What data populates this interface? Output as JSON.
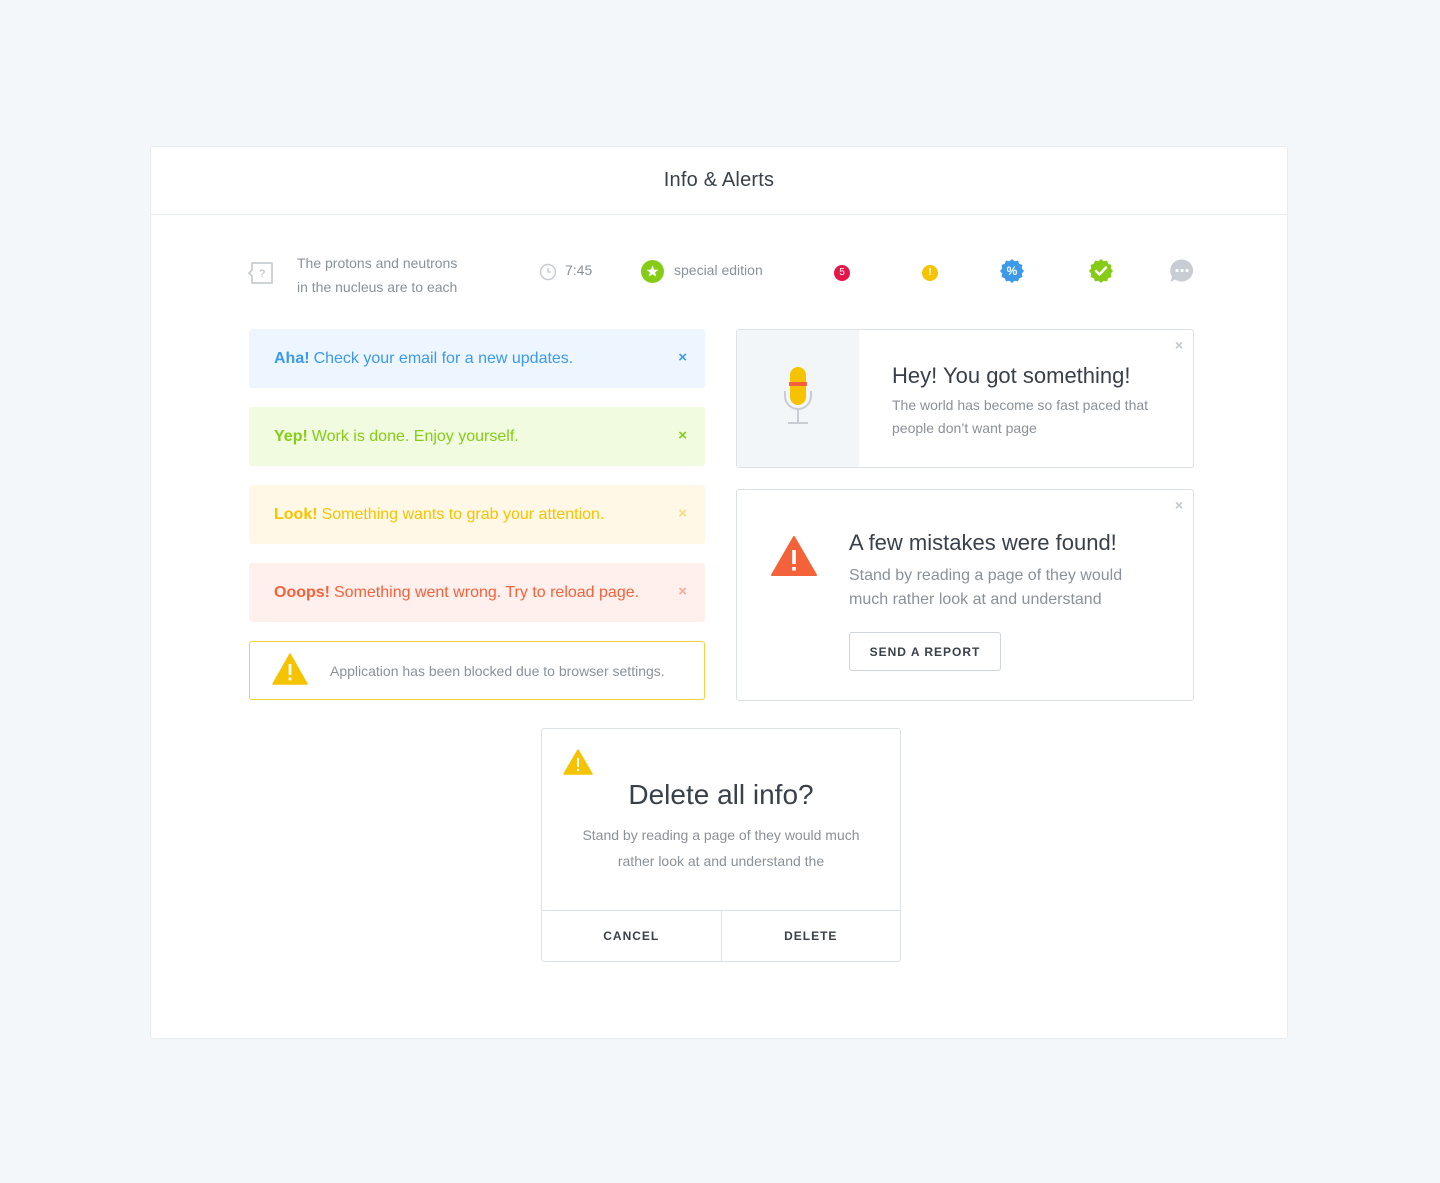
{
  "card": {
    "title": "Info & Alerts"
  },
  "toprow": {
    "question_text": [
      "The protons and neutrons",
      "in the nucleus are to each"
    ],
    "time": "7:45",
    "special": "special edition",
    "badge_count": "5",
    "badge_alert": "!",
    "percent": "%"
  },
  "alerts": [
    {
      "strong": "Aha!",
      "text": "Check your email for a new updates.",
      "close": "×"
    },
    {
      "strong": "Yep!",
      "text": "Work is done. Enjoy yourself.",
      "close": "×"
    },
    {
      "strong": "Look!",
      "text": "Something wants to grab your attention.",
      "close": "×"
    },
    {
      "strong": "Ooops!",
      "text": "Something went wrong. Try to reload page.",
      "close": "×"
    }
  ],
  "blocked_alert": {
    "text": "Application has been blocked  due to browser settings."
  },
  "notification": {
    "title": "Hey! You got something!",
    "desc": "The world has become so fast paced that people don’t want page",
    "close": "×"
  },
  "mistakes": {
    "title": "A few mistakes were found!",
    "desc": "Stand by reading a page of  they would much rather look at  and understand",
    "button": "SEND A REPORT",
    "close": "×"
  },
  "dialog": {
    "title": "Delete all info?",
    "desc": "Stand by reading a page of  they would much rather look at and understand the",
    "cancel": "CANCEL",
    "delete": "DELETE"
  },
  "colors": {
    "info": "#3d9ae8",
    "success": "#86cc16",
    "warning": "#f5c300",
    "error": "#f4623a",
    "badge_red": "#e5174a"
  },
  "icons": [
    "question-icon",
    "clock-icon",
    "star-icon",
    "percent-badge-icon",
    "check-badge-icon",
    "chat-icon",
    "microphone-icon",
    "warning-icon"
  ]
}
